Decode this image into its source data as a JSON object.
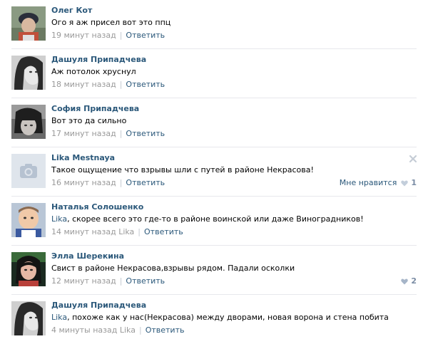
{
  "comments": [
    {
      "author": "Олег Кот",
      "text": "Ого я аж присел вот это ппц",
      "time": "19 минут назад",
      "reply": "Ответить",
      "avatar": "photo-boy-cap"
    },
    {
      "author": "Дашуля Припадчева",
      "text": "Аж потолок хруснул",
      "time": "18 минут назад",
      "reply": "Ответить",
      "avatar": "photo-girl-bw"
    },
    {
      "author": "София Припадчева",
      "text": "Вот это да сильно",
      "time": "17 минут назад",
      "reply": "Ответить",
      "avatar": "photo-girl-dark"
    },
    {
      "author": "Lika Mestnaya",
      "text": "Такое ощущение что взрывы шли с путей в районе Некрасова!",
      "time": "16 минут назад",
      "reply": "Ответить",
      "avatar": "camera-placeholder",
      "like_label": "Мне нравится",
      "like_count": "1"
    },
    {
      "author": "Наталья Солошенко",
      "mention": "Lika",
      "text": ", скорее всего это где-то в районе воинской или даже Виноградников!",
      "time": "14 минут назад",
      "ref": "Lika",
      "reply": "Ответить",
      "avatar": "photo-baby"
    },
    {
      "author": "Элла Шерекина",
      "text": "Свист в районе Некрасова,взрывы рядом. Падали осколки",
      "time": "12 минут назад",
      "reply": "Ответить",
      "avatar": "photo-woman-red",
      "like_count": "2"
    },
    {
      "author": "Дашуля Припадчева",
      "mention": "Lika",
      "text": ", похоже как у нас(Некрасова) между дворами, новая ворона и стена побита",
      "time": "4 минуты назад",
      "ref": "Lika",
      "reply": "Ответить",
      "avatar": "photo-girl-bw"
    }
  ],
  "colors": {
    "link": "#2b587a",
    "meta": "#999999",
    "divider": "#e7e8ec",
    "placeholder_bg": "#dfe5ec",
    "heart": "#a6b5c8"
  }
}
